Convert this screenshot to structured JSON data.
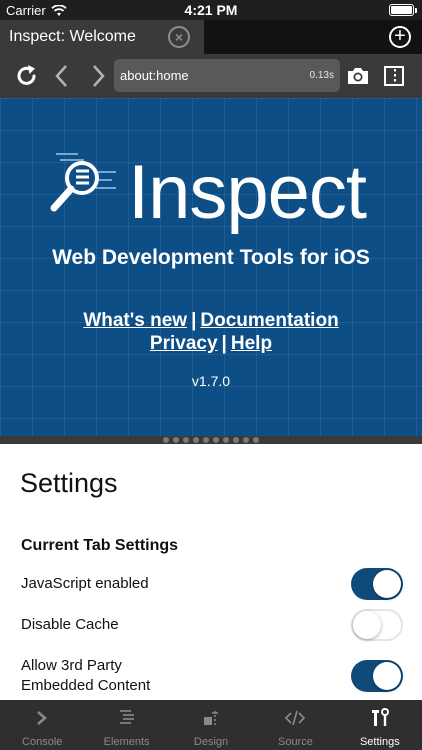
{
  "status_bar": {
    "carrier": "Carrier",
    "time": "4:21 PM"
  },
  "tab": {
    "title": "Inspect: Welcome"
  },
  "toolbar": {
    "url": "about:home",
    "load_time": "0.13s"
  },
  "page": {
    "logo_text": "Inspect",
    "tagline": "Web Development Tools for iOS",
    "links": {
      "whats_new": "What's new",
      "documentation": "Documentation",
      "privacy": "Privacy",
      "help": "Help",
      "separator": "|"
    },
    "version": "v1.7.0"
  },
  "pager": {
    "dot_count": 10
  },
  "settings": {
    "title": "Settings",
    "section_title": "Current Tab Settings",
    "rows": [
      {
        "label": "JavaScript enabled",
        "enabled": true
      },
      {
        "label": "Disable Cache",
        "enabled": false
      },
      {
        "label_line1": "Allow 3rd Party",
        "label_line2": "Embedded Content",
        "enabled": true
      }
    ]
  },
  "bottom_tabs": [
    {
      "label": "Console",
      "icon": "chevron-right-icon",
      "active": false
    },
    {
      "label": "Elements",
      "icon": "list-icon",
      "active": false
    },
    {
      "label": "Design",
      "icon": "design-icon",
      "active": false
    },
    {
      "label": "Source",
      "icon": "code-icon",
      "active": false
    },
    {
      "label": "Settings",
      "icon": "tools-icon",
      "active": true
    }
  ],
  "colors": {
    "accent": "#0f4a7a",
    "page_background": "#0e4e86",
    "chrome": "#3a3a3a"
  }
}
